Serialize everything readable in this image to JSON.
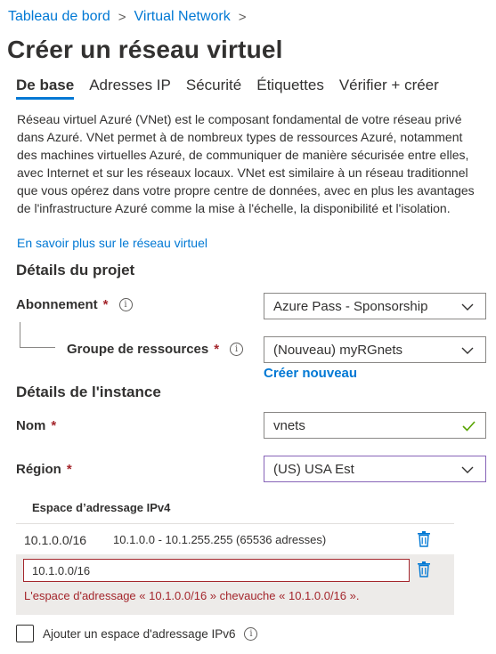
{
  "breadcrumb": {
    "items": [
      "Tableau de bord",
      "Virtual Network"
    ],
    "separator": ">"
  },
  "page_title": "Créer un réseau virtuel",
  "tabs": [
    {
      "label": "De base",
      "active": true
    },
    {
      "label": "Adresses IP",
      "active": false
    },
    {
      "label": "Sécurité",
      "active": false
    },
    {
      "label": "Étiquettes",
      "active": false
    },
    {
      "label": "Vérifier + créer",
      "active": false
    }
  ],
  "description": "Réseau virtuel Azuré (VNet) est le composant fondamental de votre réseau privé dans Azuré. VNet permet à de nombreux types de ressources Azuré, notamment des machines virtuelles Azuré, de communiquer de manière sécurisée entre elles, avec Internet et sur les réseaux locaux. VNet est similaire à un réseau traditionnel que vous opérez dans votre propre centre de données, avec en plus les avantages de l'infrastructure Azuré comme la mise à l'échelle, la disponibilité et l'isolation.",
  "learn_more": "En savoir plus sur le réseau virtuel",
  "project_details": {
    "title": "Détails du projet",
    "subscription_label": "Abonnement",
    "subscription_value": "Azure Pass - Sponsorship",
    "resource_group_label": "Groupe de ressources",
    "resource_group_value": "(Nouveau) myRGnets",
    "create_new": "Créer nouveau"
  },
  "instance_details": {
    "title": "Détails de l'instance",
    "name_label": "Nom",
    "name_value": "vnets",
    "region_label": "Région",
    "region_value": "(US) USA Est"
  },
  "required_marker": "*",
  "info_glyph": "i",
  "address_space": {
    "header": "Espace d’adressage IPv4",
    "rows": [
      {
        "cidr": "10.1.0.0/16",
        "range": "10.1.0.0 - 10.1.255.255 (65536 adresses)"
      }
    ],
    "new_entry_value": "10.1.0.0/16",
    "error_message": "L'espace d'adressage « 10.1.0.0/16 » chevauche « 10.1.0.0/16 »."
  },
  "ipv6_checkbox_label": "Ajouter un espace d'adressage IPv6",
  "colors": {
    "link": "#0078d4",
    "error": "#a4262c",
    "focus": "#8764b8",
    "valid": "#57a300"
  }
}
